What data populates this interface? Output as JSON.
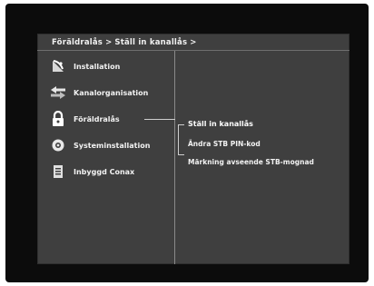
{
  "breadcrumb": {
    "first": "Föräldralås",
    "separator": ">",
    "second": "Ställ in kanallås",
    "trailing": ">"
  },
  "menu": {
    "items": [
      {
        "label": "Installation",
        "icon": "satellite-dish-icon"
      },
      {
        "label": "Kanalorganisation",
        "icon": "arrows-icon"
      },
      {
        "label": "Föräldralås",
        "icon": "padlock-icon"
      },
      {
        "label": "Systeminstallation",
        "icon": "gear-icon"
      },
      {
        "label": "Inbyggd Conax",
        "icon": "card-icon"
      }
    ],
    "selected_index": 2
  },
  "submenu": {
    "items": [
      {
        "label": "Ställ in kanallås"
      },
      {
        "label": "Ändra STB PIN-kod"
      },
      {
        "label": "Märkning avseende STB-mognad"
      }
    ],
    "selected_index": 0
  },
  "colors": {
    "screen_bg": "#3f3f3f",
    "frame_bg": "#0c0c0c",
    "text": "#f2f2f2"
  }
}
